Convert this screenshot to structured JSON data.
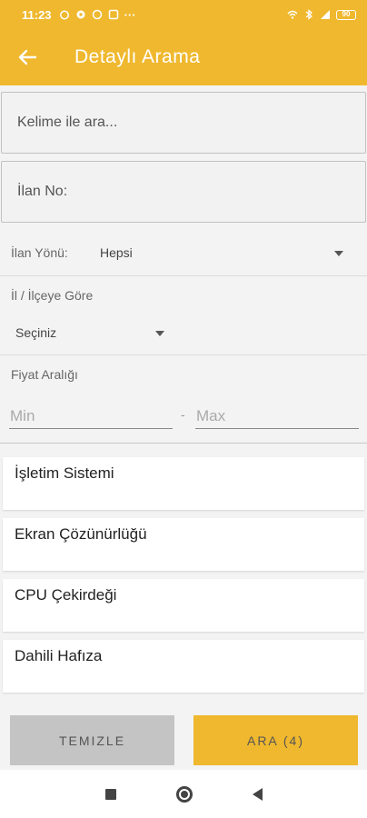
{
  "status_bar": {
    "time": "11:23",
    "battery": "90"
  },
  "header": {
    "title": "Detaylı Arama"
  },
  "search": {
    "keyword_placeholder": "Kelime ile ara...",
    "ilan_no_placeholder": "İlan No:"
  },
  "ilan_yonu": {
    "label": "İlan Yönü:",
    "value": "Hepsi"
  },
  "location": {
    "label": "İl / İlçeye Göre",
    "value": "Seçiniz"
  },
  "price": {
    "label": "Fiyat Aralığı",
    "min_placeholder": "Min",
    "separator": "-",
    "max_placeholder": "Max"
  },
  "attributes": [
    {
      "label": "İşletim Sistemi"
    },
    {
      "label": "Ekran Çözünürlüğü"
    },
    {
      "label": "CPU Çekirdeği"
    },
    {
      "label": "Dahili Hafıza"
    }
  ],
  "actions": {
    "clear_label": "TEMIZLE",
    "search_label": "ARA (4)"
  },
  "colors": {
    "accent": "#efb82e",
    "clear_button": "#c4c4c4"
  }
}
